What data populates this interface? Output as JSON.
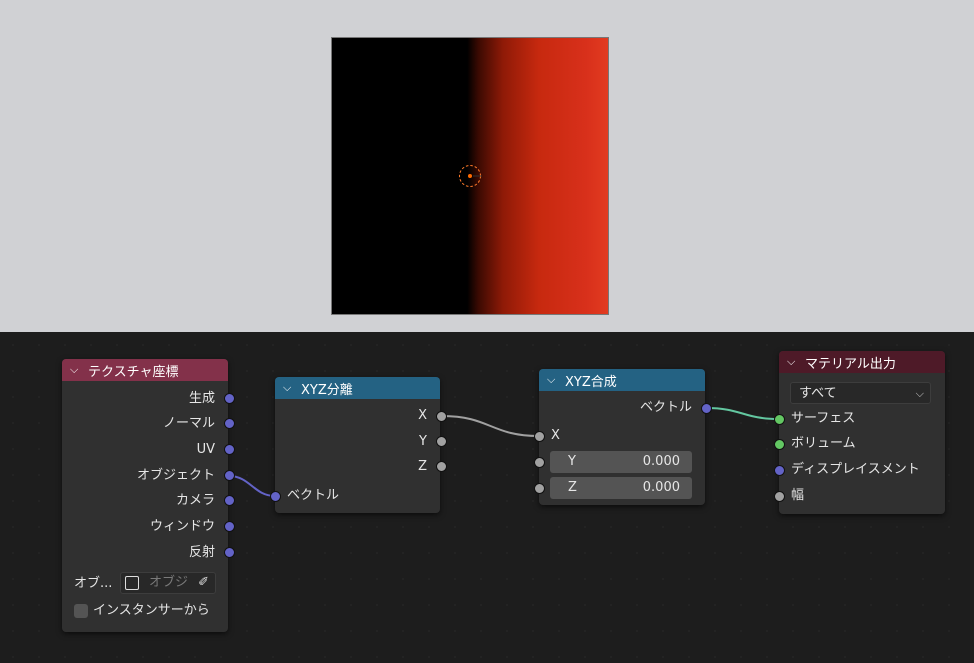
{
  "viewport": {
    "background": "#d0d1d4",
    "render_colors": [
      "#000000",
      "#8f1a07",
      "#e23b20"
    ]
  },
  "nodes": {
    "texture_coordinate": {
      "title": "テクスチャ座標",
      "header_color": "#83314a",
      "outputs": [
        "生成",
        "ノーマル",
        "UV",
        "オブジェクト",
        "カメラ",
        "ウィンドウ",
        "反射"
      ],
      "object_label": "オブ...",
      "object_placeholder": "オブジ",
      "instancer_label": "インスタンサーから"
    },
    "separate_xyz": {
      "title": "XYZ分離",
      "header_color": "#246283",
      "outputs": [
        "X",
        "Y",
        "Z"
      ],
      "input": "ベクトル"
    },
    "combine_xyz": {
      "title": "XYZ合成",
      "header_color": "#246283",
      "output": "ベクトル",
      "input_x": "X",
      "y_label": "Y",
      "y_value": "0.000",
      "z_label": "Z",
      "z_value": "0.000"
    },
    "material_output": {
      "title": "マテリアル出力",
      "header_color": "#4e1a28",
      "target": "すべて",
      "inputs": [
        "サーフェス",
        "ボリューム",
        "ディスプレイスメント",
        "幅"
      ]
    }
  }
}
